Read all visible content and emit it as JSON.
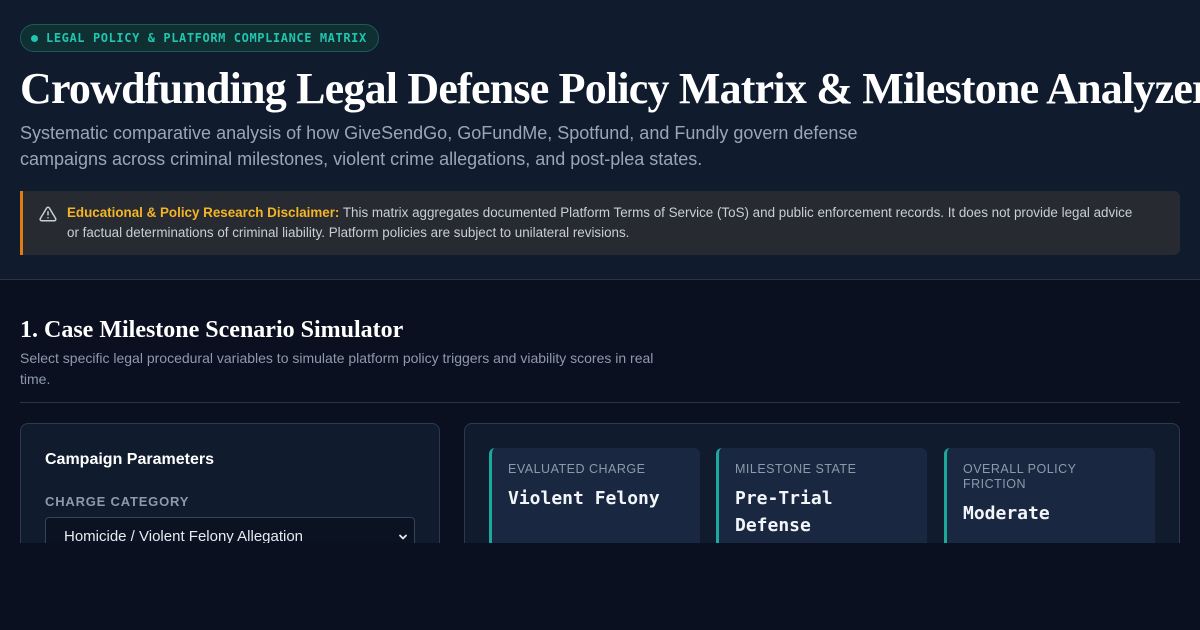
{
  "header": {
    "badge": "LEGAL POLICY & PLATFORM COMPLIANCE MATRIX",
    "title": "Crowdfunding Legal Defense Policy Matrix & Milestone Analyzer",
    "subtitle": "Systematic comparative analysis of how GiveSendGo, GoFundMe, Spotfund, and Fundly govern defense campaigns across criminal milestones, violent crime allegations, and post-plea states."
  },
  "disclaimer": {
    "icon": "warning-triangle-icon",
    "heading": "Educational & Policy Research Disclaimer:",
    "body": "This matrix aggregates documented Platform Terms of Service (ToS) and public enforcement records. It does not provide legal advice or factual determinations of criminal liability. Platform policies are subject to unilateral revisions."
  },
  "simulator": {
    "title": "1. Case Milestone Scenario Simulator",
    "description": "Select specific legal procedural variables to simulate platform policy triggers and viability scores in real time.",
    "parameters": {
      "title": "Campaign Parameters",
      "charge_category_label": "CHARGE CATEGORY",
      "charge_category_value": "Homicide / Violent Felony Allegation"
    },
    "stats": [
      {
        "label": "EVALUATED CHARGE",
        "value": "Violent Felony"
      },
      {
        "label": "MILESTONE STATE",
        "value": "Pre-Trial Defense"
      },
      {
        "label": "OVERALL POLICY FRICTION",
        "value": "Moderate"
      }
    ]
  },
  "colors": {
    "accent": "#20c5ae",
    "warning": "#e07b16",
    "warning_text": "#f5b524",
    "background": "#0a101f"
  }
}
